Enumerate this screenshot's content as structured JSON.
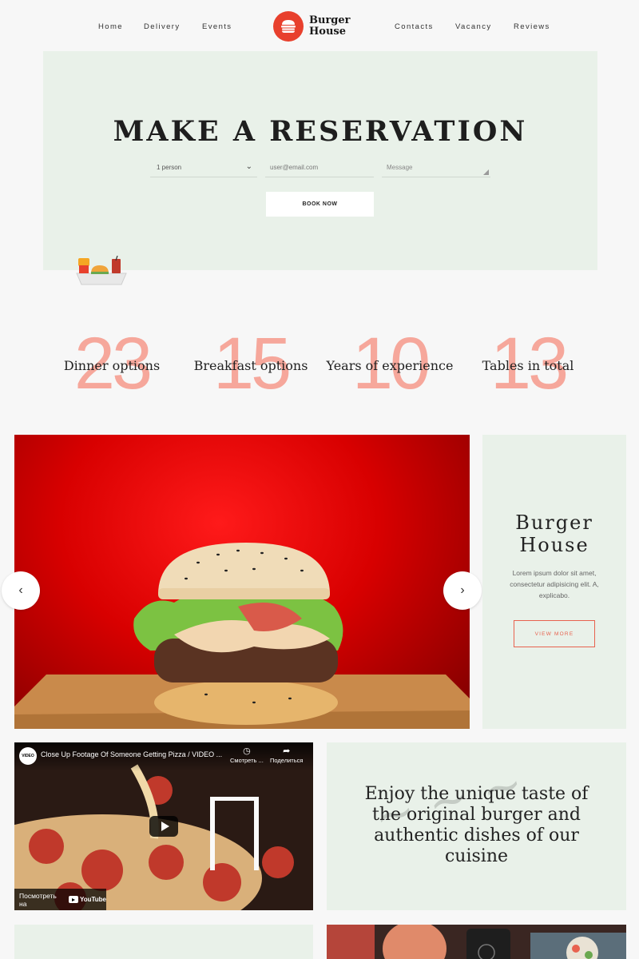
{
  "nav": {
    "left": [
      "Home",
      "Delivery",
      "Events"
    ],
    "right": [
      "Contacts",
      "Vacancy",
      "Reviews"
    ],
    "logo_line1": "Burger",
    "logo_line2": "House"
  },
  "reservation": {
    "title": "MAKE A RESERVATION",
    "persons_value": "1 person",
    "email_placeholder": "user@email.com",
    "message_placeholder": "Message",
    "book_label": "BOOK NOW"
  },
  "stats": [
    {
      "number": "23",
      "label": "Dinner options"
    },
    {
      "number": "15",
      "label": "Breakfast options"
    },
    {
      "number": "10",
      "label": "Years of experience"
    },
    {
      "number": "13",
      "label": "Tables in total"
    }
  ],
  "slider": {
    "prev_icon": "‹",
    "next_icon": "›"
  },
  "about": {
    "title_line1": "Burger",
    "title_line2": "House",
    "text": "Lorem ipsum dolor sit amet, consectetur adipisicing elit. A, explicabo.",
    "button": "VIEW MORE"
  },
  "video": {
    "channel_badge": "VIDEO",
    "title": "Close Up Footage Of Someone Getting Pizza / VIDEO ...",
    "watch_later": "Смотреть ...",
    "share": "Поделиться",
    "watch_on": "Посмотреть на",
    "youtube": "YouTube"
  },
  "quote": {
    "text": "Enjoy the unique taste of the original burger and authentic dishes of our cuisine"
  },
  "colors": {
    "accent": "#e8402d",
    "mint": "#e9f1e9",
    "stat_number": "#f6a79b"
  }
}
